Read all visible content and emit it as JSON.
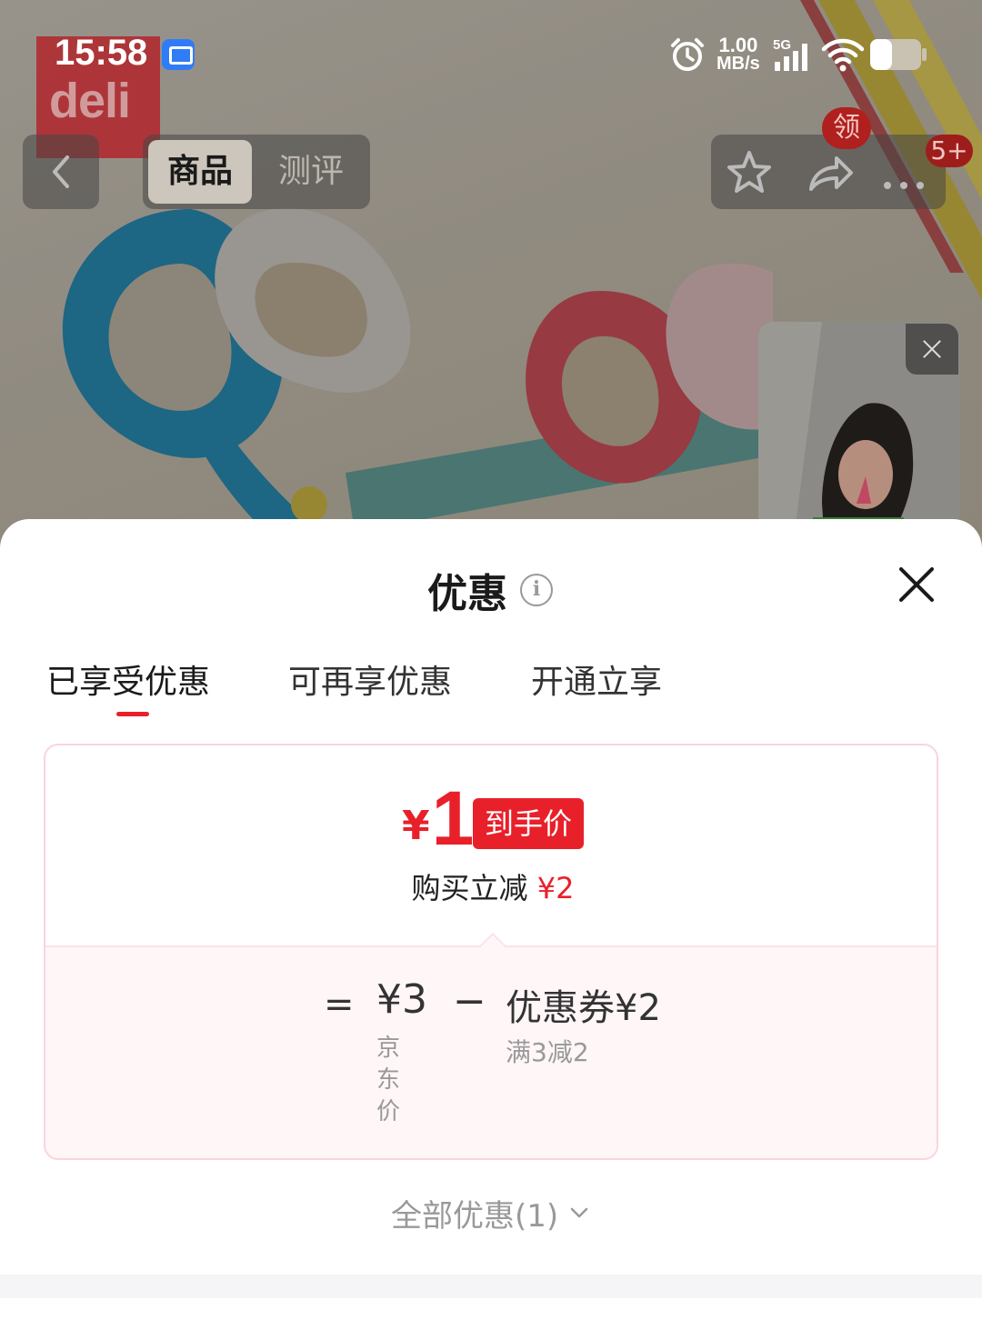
{
  "status_bar": {
    "time": "15:58",
    "brand_logo_text": "deli",
    "net_speed_value": "1.00",
    "net_speed_unit": "MB/s",
    "network_type": "5G"
  },
  "nav": {
    "tabs": [
      {
        "label": "商品",
        "active": true
      },
      {
        "label": "测评",
        "active": false
      }
    ],
    "coupon_badge": "领",
    "message_badge": "5+"
  },
  "sheet": {
    "title": "优惠",
    "tabs": [
      {
        "label": "已享受优惠",
        "active": true
      },
      {
        "label": "可再享优惠",
        "active": false
      },
      {
        "label": "开通立享",
        "active": false
      }
    ],
    "final_price": {
      "currency": "¥",
      "amount": "1",
      "tag": "到手价"
    },
    "instant_discount": {
      "label": "购买立减",
      "amount": "¥2"
    },
    "formula": {
      "equals": "=",
      "base_price": "¥3",
      "base_price_label": "京东价",
      "minus": "−",
      "coupon": "优惠券¥2",
      "coupon_condition": "满3减2"
    },
    "all_offers": "全部优惠(1)"
  },
  "colors": {
    "accent": "#e8202a",
    "card_border": "#fbd4dc",
    "card_bottom_bg": "#fff6f7",
    "muted_text": "#999999"
  }
}
